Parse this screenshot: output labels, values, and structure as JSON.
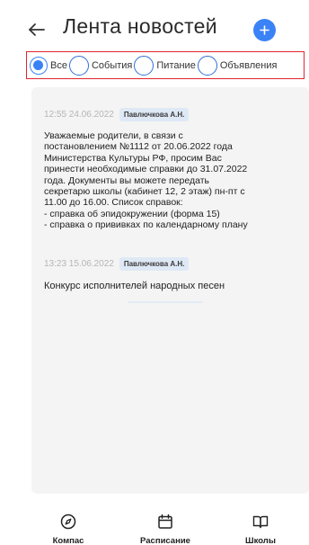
{
  "header": {
    "title": "Лента новостей"
  },
  "filters": [
    {
      "label": "Все",
      "selected": true
    },
    {
      "label": "События",
      "selected": false
    },
    {
      "label": "Питание",
      "selected": false
    },
    {
      "label": "Объявления",
      "selected": false
    }
  ],
  "news": [
    {
      "time": "12:55 24.06.2022",
      "author": "Павлючкова А.Н.",
      "text": "Уважаемые родители, в связи с\nпостановлением №1112 от 20.06.2022 года\nМинистерства Культуры РФ, просим Вас\nпринести необходимые справки до 31.07.2022\nгода. Документы вы можете передать\nсекретарю школы (кабинет 12, 2 этаж) пн-пт с\n11.00 до 16.00. Список справок:\n- справка об эпидокружении (форма 15)\n- справка о прививках по календарному плану"
    },
    {
      "time": "13:23 15.06.2022",
      "author": "Павлючкова А.Н.",
      "text": "Конкурс исполнителей народных песен"
    }
  ],
  "bottom_nav": [
    {
      "label": "Компас",
      "icon": "compass-icon"
    },
    {
      "label": "Расписание",
      "icon": "calendar-icon"
    },
    {
      "label": "Школы",
      "icon": "book-icon"
    }
  ],
  "colors": {
    "accent": "#3b82f6",
    "highlight_border": "#e0242e",
    "card_background": "#f4f4f4",
    "author_badge": "#dfe9f6"
  }
}
